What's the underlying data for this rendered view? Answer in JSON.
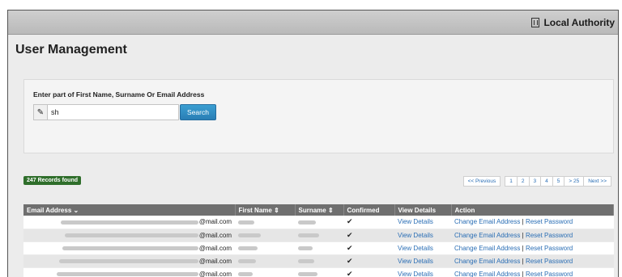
{
  "header": {
    "org_name": "Local Authority"
  },
  "page_title": "User Management",
  "search": {
    "label": "Enter part of First Name, Surname Or Email Address",
    "value": "sh",
    "button_label": "Search"
  },
  "records_found": "247 Records found",
  "pagination": {
    "previous": "<< Previous",
    "pages": [
      "1",
      "2",
      "3",
      "4",
      "5",
      "> 25"
    ],
    "next": "Next >>"
  },
  "table": {
    "columns": [
      "Email Address ⌄",
      "First Name ⇕",
      "Surname ⇕",
      "Confirmed",
      "View Details",
      "Action"
    ],
    "rows": [
      {
        "email_suffix": "@mail.com",
        "confirmed": "✔",
        "view": "View Details",
        "change": "Change Email Address",
        "sep": "|",
        "reset": "Reset Password"
      },
      {
        "email_suffix": "@mail.com",
        "confirmed": "✔",
        "view": "View Details",
        "change": "Change Email Address",
        "sep": "|",
        "reset": "Reset Password"
      },
      {
        "email_suffix": "@mail.com",
        "confirmed": "✔",
        "view": "View Details",
        "change": "Change Email Address",
        "sep": "|",
        "reset": "Reset Password"
      },
      {
        "email_suffix": "@mail.com",
        "confirmed": "✔",
        "view": "View Details",
        "change": "Change Email Address",
        "sep": "|",
        "reset": "Reset Password"
      },
      {
        "email_suffix": "@mail.com",
        "confirmed": "✔",
        "view": "View Details",
        "change": "Change Email Address",
        "sep": "|",
        "reset": "Reset Password"
      }
    ]
  }
}
